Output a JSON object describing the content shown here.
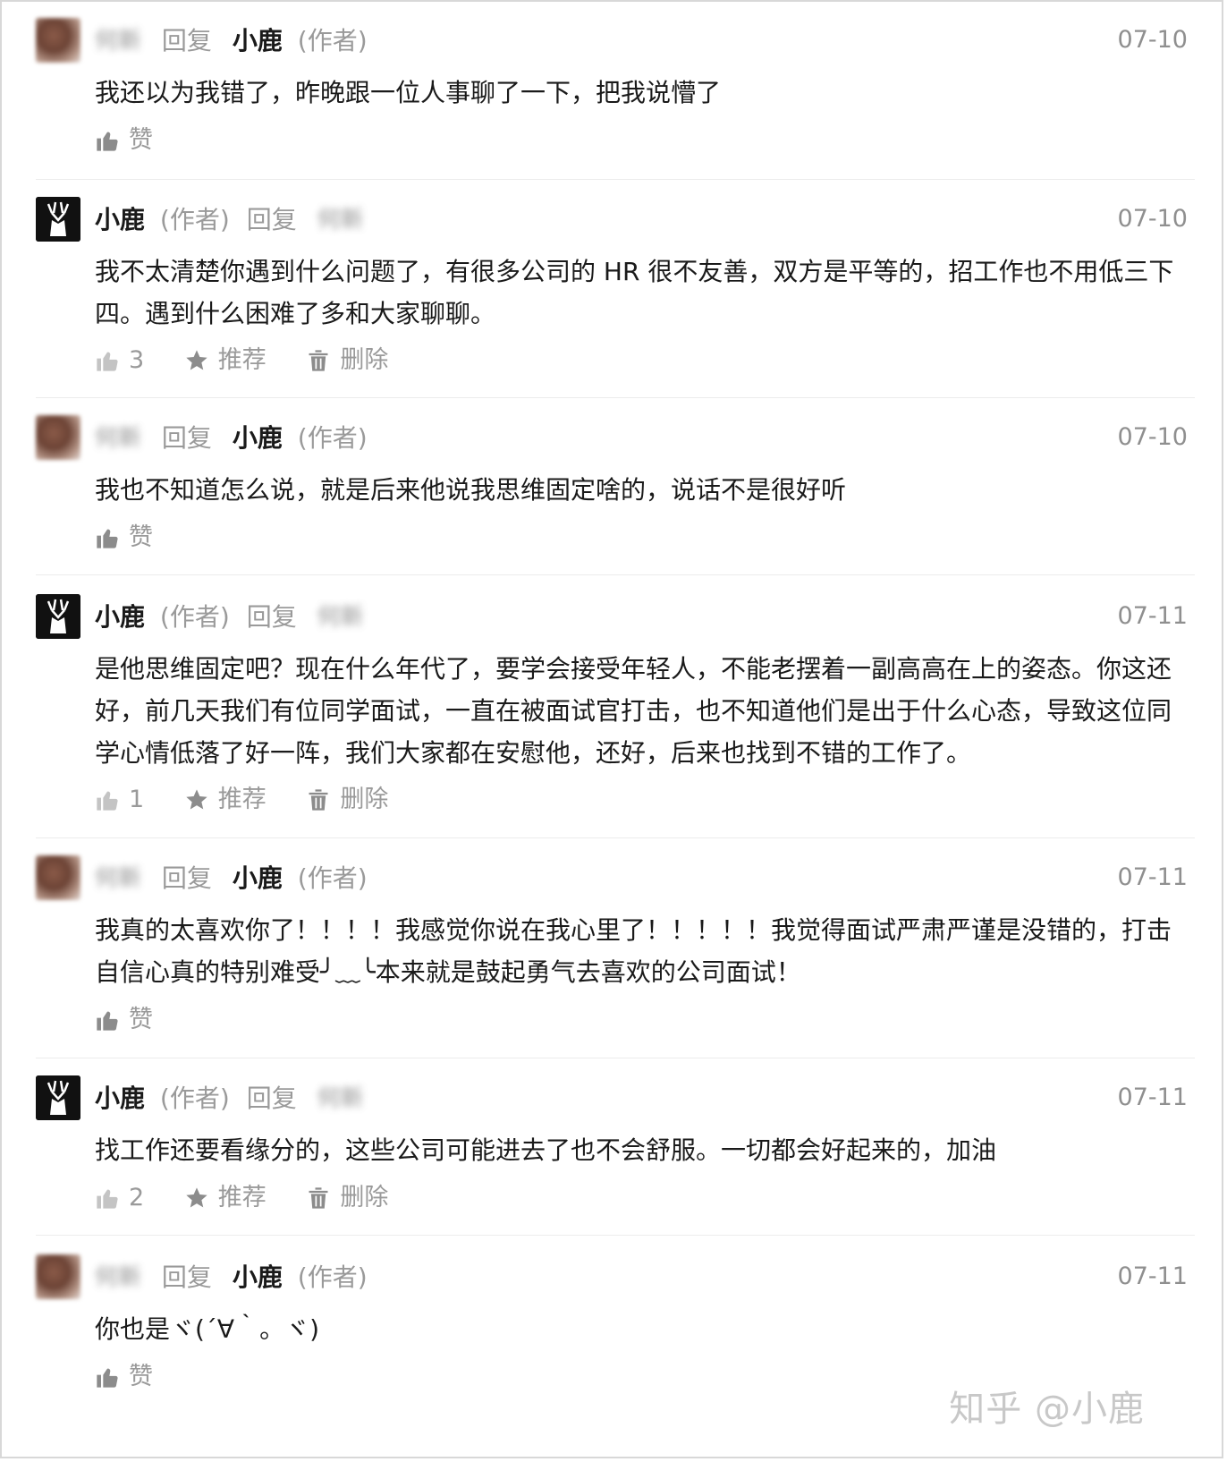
{
  "reply_word": "回复",
  "author_tag": "(作者)",
  "author_name": "小鹿",
  "blurred_user": "何新",
  "like_label": "赞",
  "recommend_label": "推荐",
  "delete_label": "删除",
  "watermark": "知乎 @小鹿",
  "comments": [
    {
      "date": "07-10",
      "text": "我还以为我错了，昨晚跟一位人事聊了一下，把我说懵了"
    },
    {
      "date": "07-10",
      "text": "我不太清楚你遇到什么问题了，有很多公司的 HR 很不友善，双方是平等的，招工作也不用低三下四。遇到什么困难了多和大家聊聊。",
      "likes": "3"
    },
    {
      "date": "07-10",
      "text": "我也不知道怎么说，就是后来他说我思维固定啥的，说话不是很好听"
    },
    {
      "date": "07-11",
      "text": "是他思维固定吧？现在什么年代了，要学会接受年轻人，不能老摆着一副高高在上的姿态。你这还好，前几天我们有位同学面试，一直在被面试官打击，也不知道他们是出于什么心态，导致这位同学心情低落了好一阵，我们大家都在安慰他，还好，后来也找到不错的工作了。",
      "likes": "1"
    },
    {
      "date": "07-11",
      "text": "我真的太喜欢你了！！！！我感觉你说在我心里了！！！！！我觉得面试严肃严谨是没错的，打击自信心真的特别难受╯﹏╰本来就是鼓起勇气去喜欢的公司面试！"
    },
    {
      "date": "07-11",
      "text": "找工作还要看缘分的，这些公司可能进去了也不会舒服。一切都会好起来的，加油",
      "likes": "2"
    },
    {
      "date": "07-11",
      "text": "你也是ヾ(´∀｀。ヾ)"
    }
  ]
}
